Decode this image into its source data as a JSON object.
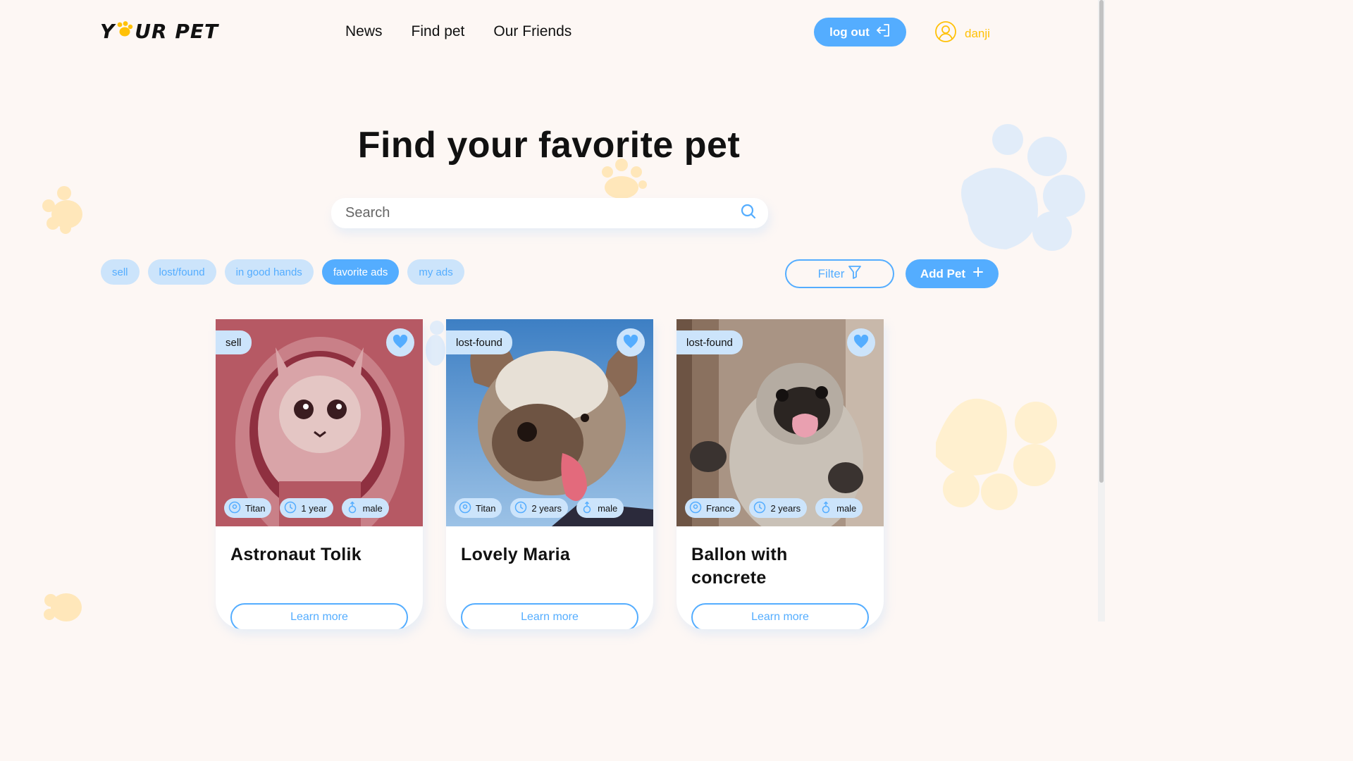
{
  "header": {
    "logo_left": "Y",
    "logo_right": "UR PET",
    "nav": [
      "News",
      "Find pet",
      "Our Friends"
    ],
    "logout_label": "log out",
    "username": "danji"
  },
  "hero": {
    "title": "Find your favorite pet",
    "search_placeholder": "Search"
  },
  "filters": {
    "chips": [
      "sell",
      "lost/found",
      "in good hands",
      "favorite ads",
      "my ads"
    ],
    "active_chip": "favorite ads",
    "filter_label": "Filter",
    "add_label": "Add Pet"
  },
  "cards": [
    {
      "category": "sell",
      "location": "Titan",
      "age": "1 year",
      "sex": "male",
      "name": "Astronaut Tolik",
      "button": "Learn more"
    },
    {
      "category": "lost-found",
      "location": "Titan",
      "age": "2 years",
      "sex": "male",
      "name": "Lovely Maria",
      "button": "Learn more"
    },
    {
      "category": "lost-found",
      "location": "France",
      "age": "2 years",
      "sex": "male",
      "name": "Ballon with concrete",
      "button": "Learn more"
    }
  ],
  "icons": {
    "logout": "logout-icon",
    "user": "user-circle-icon",
    "search": "search-icon",
    "filter": "filter-icon",
    "add": "plus-icon",
    "favorite": "heart-icon",
    "location": "location-icon",
    "age": "clock-icon",
    "sex": "male-icon"
  },
  "colors": {
    "accent": "#54adff",
    "accent_light": "#cce4fb",
    "brand_yellow": "#ffc107",
    "background": "#fdf7f4"
  }
}
